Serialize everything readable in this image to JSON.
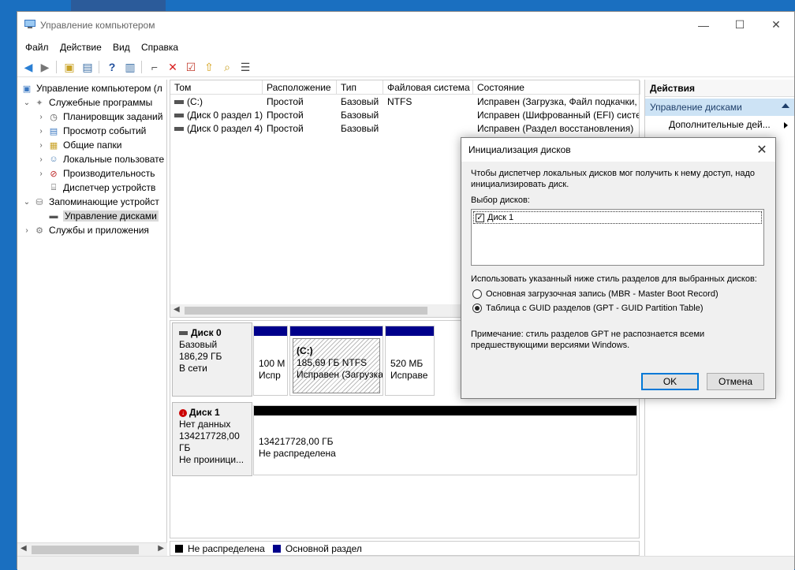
{
  "window": {
    "title": "Управление компьютером",
    "controls": [
      "—",
      "☐",
      "✕"
    ]
  },
  "menu": [
    "Файл",
    "Действие",
    "Вид",
    "Справка"
  ],
  "tree": {
    "root": "Управление компьютером (л",
    "items": [
      {
        "label": "Служебные программы",
        "level": 1,
        "expander": "⌄",
        "icon": "tools-icon"
      },
      {
        "label": "Планировщик заданий",
        "level": 2,
        "expander": "›",
        "icon": "clock-icon"
      },
      {
        "label": "Просмотр событий",
        "level": 2,
        "expander": "›",
        "icon": "event-viewer-icon"
      },
      {
        "label": "Общие папки",
        "level": 2,
        "expander": "›",
        "icon": "shared-folder-icon"
      },
      {
        "label": "Локальные пользовате",
        "level": 2,
        "expander": "›",
        "icon": "users-icon"
      },
      {
        "label": "Производительность",
        "level": 2,
        "expander": "›",
        "icon": "performance-icon"
      },
      {
        "label": "Диспетчер устройств",
        "level": 2,
        "expander": "",
        "icon": "device-manager-icon"
      },
      {
        "label": "Запоминающие устройст",
        "level": 1,
        "expander": "⌄",
        "icon": "storage-icon"
      },
      {
        "label": "Управление дисками",
        "level": 2,
        "expander": "",
        "icon": "disk-management-icon",
        "selected": true
      },
      {
        "label": "Службы и приложения",
        "level": 1,
        "expander": "›",
        "icon": "services-icon"
      }
    ]
  },
  "volume_list": {
    "columns": [
      "Том",
      "Расположение",
      "Тип",
      "Файловая система",
      "Состояние"
    ],
    "rows": [
      [
        "(C:)",
        "Простой",
        "Базовый",
        "NTFS",
        "Исправен (Загрузка, Файл подкачки,"
      ],
      [
        "(Диск 0 раздел 1)",
        "Простой",
        "Базовый",
        "",
        "Исправен (Шифрованный (EFI) систе"
      ],
      [
        "(Диск 0 раздел 4)",
        "Простой",
        "Базовый",
        "",
        "Исправен (Раздел восстановления)"
      ]
    ]
  },
  "disks": [
    {
      "name": "Диск 0",
      "lines": [
        "Базовый",
        "186,29 ГБ",
        "В сети"
      ]
    },
    {
      "name": "Диск 1",
      "lines": [
        "Нет данных",
        "134217728,00 ГБ",
        "Не проиници..."
      ]
    }
  ],
  "partitions": {
    "p1": [
      "100 М",
      "Испр"
    ],
    "p2": [
      "(C:)",
      "185,69 ГБ NTFS",
      "Исправен (Загрузка"
    ],
    "p3": [
      "520 МБ",
      "Исправе"
    ],
    "unalloc": [
      "134217728,00 ГБ",
      "Не распределена"
    ]
  },
  "legend": {
    "unallocated": "Не распределена",
    "primary": "Основной раздел",
    "colors": {
      "unallocated": "#000000",
      "primary": "#00008b"
    }
  },
  "actions": {
    "header": "Действия",
    "section": "Управление дисками",
    "item": "Дополнительные дей..."
  },
  "dialog": {
    "title": "Инициализация дисков",
    "intro": "Чтобы диспетчер локальных дисков мог получить к нему доступ, надо инициализировать диск.",
    "select_label": "Выбор дисков:",
    "disk_item": "Диск 1",
    "disk_checked": true,
    "style_label": "Использовать указанный ниже стиль разделов для выбранных дисков:",
    "mbr": "Основная загрузочная запись (MBR - Master Boot Record)",
    "gpt": "Таблица с GUID разделов (GPT - GUID Partition Table)",
    "selected": "gpt",
    "note": "Примечание: стиль разделов GPT не распознается всеми предшествующими версиями Windows.",
    "ok": "OK",
    "cancel": "Отмена"
  }
}
